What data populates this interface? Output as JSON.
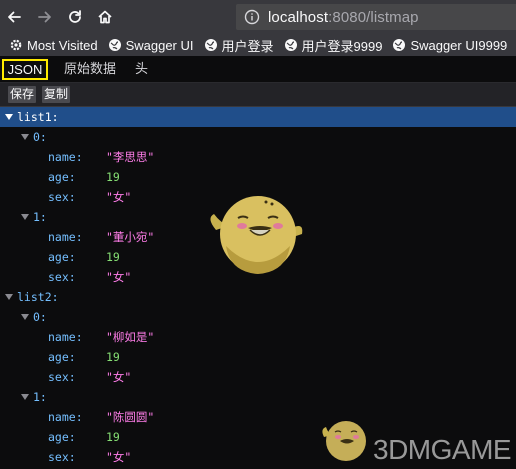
{
  "browser": {
    "url_host": "localhost",
    "url_rest": ":8080/listmap",
    "nav_icons": [
      "back-arrow-icon",
      "forward-arrow-icon",
      "reload-icon",
      "home-icon"
    ]
  },
  "bookmarks": [
    {
      "label": "Most Visited",
      "icon": "gear-icon"
    },
    {
      "label": "Swagger UI",
      "icon": "globe-icon"
    },
    {
      "label": "用户登录",
      "icon": "globe-icon"
    },
    {
      "label": "用户登录9999",
      "icon": "globe-icon"
    },
    {
      "label": "Swagger UI9999",
      "icon": "globe-icon"
    }
  ],
  "viewer_tabs": {
    "json": "JSON",
    "raw": "原始数据",
    "headers": "头"
  },
  "actions": {
    "save": "保存",
    "copy": "复制"
  },
  "tree": {
    "list1": {
      "key": "list1:",
      "items": [
        {
          "index": "0:",
          "name": "\"李思思\"",
          "age": "19",
          "sex": "\"女\""
        },
        {
          "index": "1:",
          "name": "\"董小宛\"",
          "age": "19",
          "sex": "\"女\""
        }
      ]
    },
    "list2": {
      "key": "list2:",
      "items": [
        {
          "index": "0:",
          "name": "\"柳如是\"",
          "age": "19",
          "sex": "\"女\""
        },
        {
          "index": "1:",
          "name": "\"陈圆圆\"",
          "age": "19",
          "sex": "\"女\""
        }
      ]
    },
    "labels": {
      "name": "name:",
      "age": "age:",
      "sex": "sex:"
    }
  },
  "watermark": {
    "text": "3DMGAME"
  }
}
